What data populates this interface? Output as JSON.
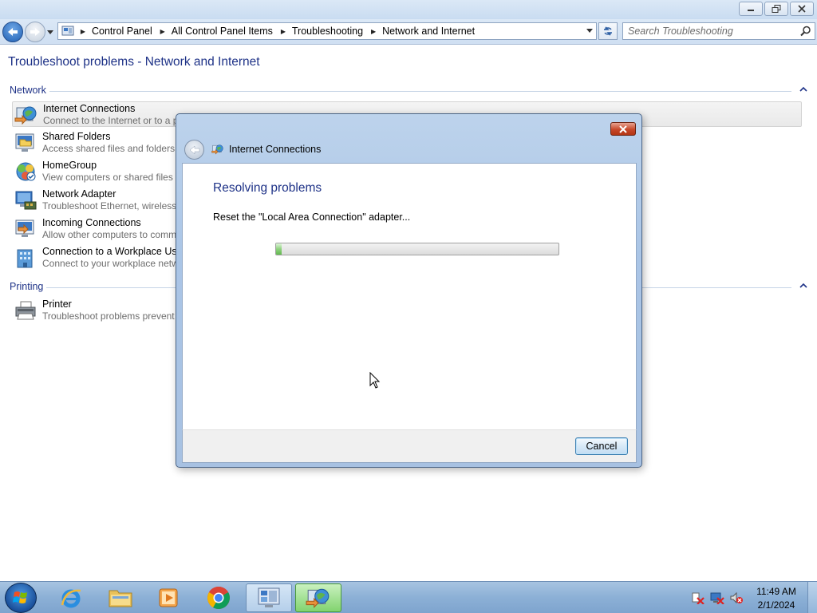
{
  "window": {
    "address": {
      "crumbs": [
        "Control Panel",
        "All Control Panel Items",
        "Troubleshooting",
        "Network and Internet"
      ]
    },
    "search_placeholder": "Search Troubleshooting",
    "page_title": "Troubleshoot problems - Network and Internet",
    "groups": [
      {
        "label": "Network",
        "items": [
          {
            "name": "Internet Connections",
            "desc": "Connect to the Internet or to a p",
            "icon": "internet-connections-icon"
          },
          {
            "name": "Shared Folders",
            "desc": "Access shared files and folders o",
            "icon": "shared-folders-icon"
          },
          {
            "name": "HomeGroup",
            "desc": "View computers or shared files i",
            "icon": "homegroup-icon"
          },
          {
            "name": "Network Adapter",
            "desc": "Troubleshoot Ethernet, wireless,",
            "icon": "network-adapter-icon"
          },
          {
            "name": "Incoming Connections",
            "desc": "Allow other computers to comm",
            "icon": "incoming-connections-icon"
          },
          {
            "name": "Connection to a Workplace Usin",
            "desc": "Connect to your workplace netw",
            "icon": "workplace-connection-icon"
          }
        ]
      },
      {
        "label": "Printing",
        "items": [
          {
            "name": "Printer",
            "desc": "Troubleshoot problems prevent",
            "icon": "printer-icon"
          }
        ]
      }
    ]
  },
  "dialog": {
    "title": "Internet Connections",
    "heading": "Resolving problems",
    "status": "Reset the \"Local Area Connection\" adapter...",
    "progress_fraction": 0.02,
    "cancel_label": "Cancel"
  },
  "taskbar": {
    "pinned": [
      "internet-explorer-icon",
      "windows-explorer-icon",
      "media-player-icon",
      "chrome-icon",
      "control-panel-icon",
      "troubleshooter-icon"
    ],
    "tray_icons": [
      "action-center-icon",
      "network-icon",
      "volume-muted-icon"
    ],
    "time": "11:49 AM",
    "date": "2/1/2024"
  },
  "colors": {
    "heading_blue": "#1e3287",
    "desc_gray": "#6d6d6d",
    "taskbar": "#8cb0d6"
  }
}
